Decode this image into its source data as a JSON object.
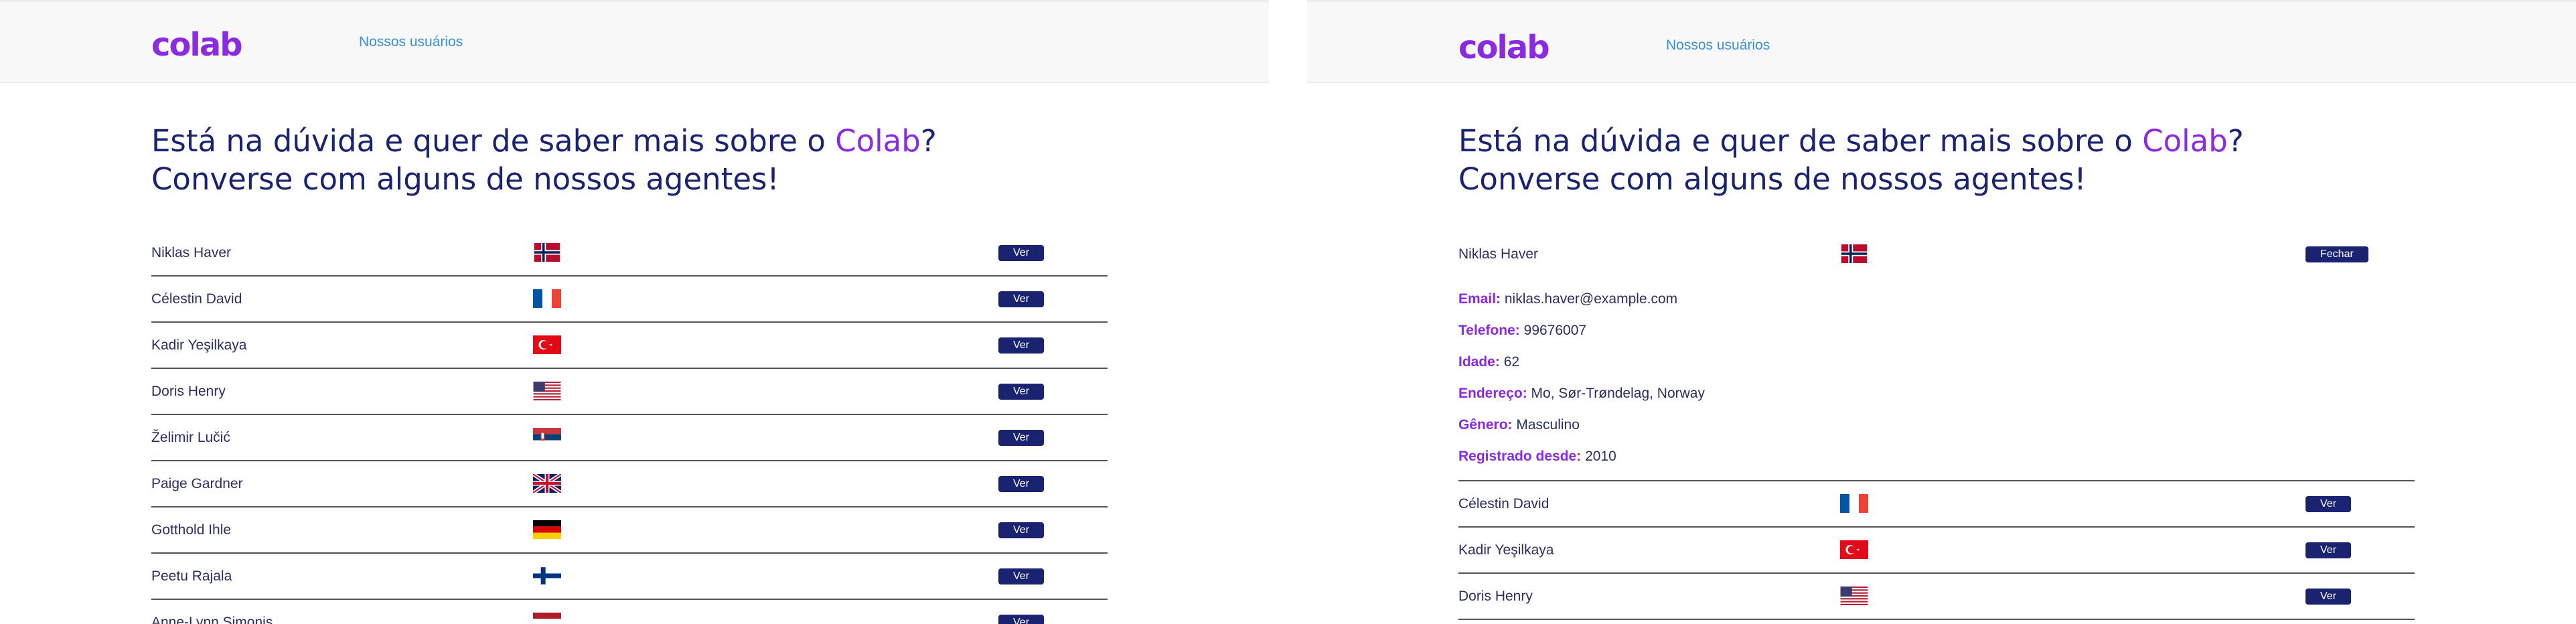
{
  "app": {
    "logo": "colab",
    "nav_link": "Nossos usuários",
    "title_pre": "Está na dúvida e quer de saber mais sobre o ",
    "title_brand": "Colab",
    "title_post": "?",
    "title_line2": "Converse com alguns de nossos agentes!"
  },
  "colors": {
    "brand": "#8a2be2",
    "navy": "#1a2370",
    "link": "#3a8fd6"
  },
  "left_panel": {
    "users": [
      {
        "name": "Niklas Haver",
        "flag": "norway-flag-icon",
        "button": "Ver"
      },
      {
        "name": "Célestin David",
        "flag": "france-flag-icon",
        "button": "Ver"
      },
      {
        "name": "Kadir Yeşilkaya",
        "flag": "turkey-flag-icon",
        "button": "Ver"
      },
      {
        "name": "Doris Henry",
        "flag": "usa-flag-icon",
        "button": "Ver"
      },
      {
        "name": "Želimir Lučić",
        "flag": "serbia-flag-icon",
        "button": "Ver"
      },
      {
        "name": "Paige Gardner",
        "flag": "uk-flag-icon",
        "button": "Ver"
      },
      {
        "name": "Gotthold Ihle",
        "flag": "germany-flag-icon",
        "button": "Ver"
      },
      {
        "name": "Peetu Rajala",
        "flag": "finland-flag-icon",
        "button": "Ver"
      },
      {
        "name": "Anne-Lynn Simonis",
        "flag": "netherlands-flag-icon",
        "button": "Ver"
      }
    ]
  },
  "right_panel": {
    "expanded": {
      "name": "Niklas Haver",
      "flag": "norway-flag-icon",
      "button": "Fechar",
      "details": [
        {
          "label": "Email:",
          "value": "niklas.haver@example.com"
        },
        {
          "label": "Telefone:",
          "value": "99676007"
        },
        {
          "label": "Idade:",
          "value": "62"
        },
        {
          "label": "Endereço:",
          "value": "Mo, Sør-Trøndelag, Norway"
        },
        {
          "label": "Gênero:",
          "value": "Masculino"
        },
        {
          "label": "Registrado desde:",
          "value": "2010"
        }
      ]
    },
    "users": [
      {
        "name": "Célestin David",
        "flag": "france-flag-icon",
        "button": "Ver"
      },
      {
        "name": "Kadir Yeşilkaya",
        "flag": "turkey-flag-icon",
        "button": "Ver"
      },
      {
        "name": "Doris Henry",
        "flag": "usa-flag-icon",
        "button": "Ver"
      }
    ]
  }
}
